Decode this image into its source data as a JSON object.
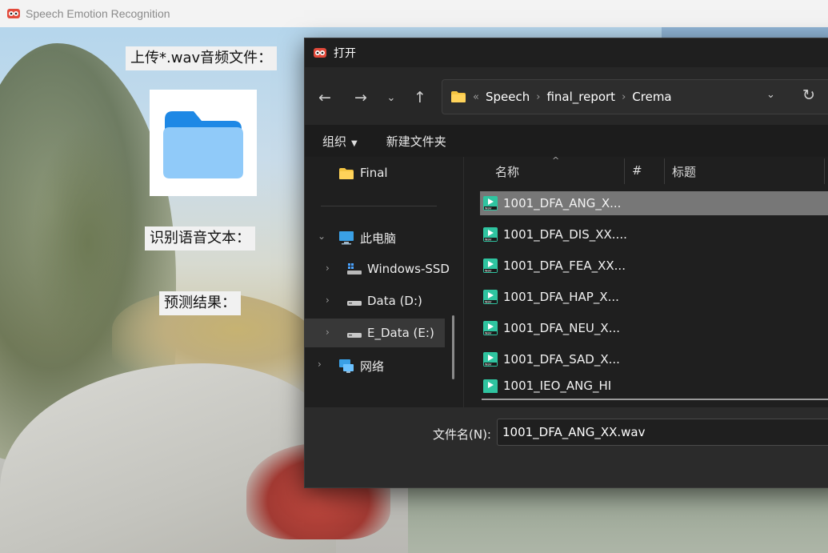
{
  "app": {
    "title": "Speech Emotion Recognition",
    "labels": {
      "upload": "上传*.wav音频文件：",
      "recognize_text": "识别语音文本：",
      "prediction": "预测结果："
    }
  },
  "dialog": {
    "title": "打开",
    "address": {
      "overflow": "«",
      "segments": [
        "Speech",
        "final_report",
        "Crema"
      ]
    },
    "toolbar": {
      "organize": "组织",
      "new_folder": "新建文件夹"
    },
    "nav_pane": [
      {
        "label": "Final",
        "icon": "folder-icon"
      },
      {
        "label": "此电脑",
        "icon": "computer-icon",
        "expanded": true
      },
      {
        "label": "Windows-SSD",
        "icon": "windows-drive-icon"
      },
      {
        "label": "Data (D:)",
        "icon": "drive-icon"
      },
      {
        "label": "E_Data (E:)",
        "icon": "drive-icon",
        "selected": true
      },
      {
        "label": "网络",
        "icon": "network-icon"
      }
    ],
    "columns": {
      "name": "名称",
      "number": "#",
      "title": "标题"
    },
    "files": [
      {
        "name": "1001_DFA_ANG_X...",
        "selected": true
      },
      {
        "name": "1001_DFA_DIS_XX...."
      },
      {
        "name": "1001_DFA_FEA_XX..."
      },
      {
        "name": "1001_DFA_HAP_X..."
      },
      {
        "name": "1001_DFA_NEU_X..."
      },
      {
        "name": "1001_DFA_SAD_X..."
      },
      {
        "name": "1001_IEO_ANG_HI"
      }
    ],
    "footer": {
      "filename_label": "文件名(N):",
      "filename_value": "1001_DFA_ANG_XX.wav"
    }
  },
  "colors": {
    "dialog_bg": "#202020",
    "selection": "#777777",
    "folder": "#f5c542",
    "wav_icon": "#2fc4a0"
  }
}
